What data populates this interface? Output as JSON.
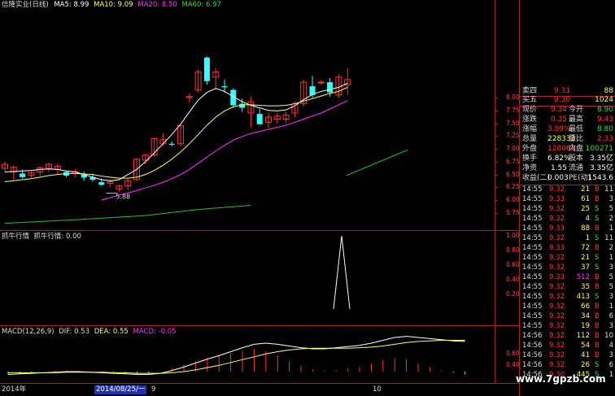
{
  "main_chart": {
    "title": "信隆实业(日线)",
    "ma5": {
      "label": "MA5:",
      "value": "8.99",
      "color": "#ffffff"
    },
    "ma10": {
      "label": "MA10:",
      "value": "9.09",
      "color": "#ffff66"
    },
    "ma20": {
      "label": "MA20:",
      "value": "8.50",
      "color": "#ff33ff"
    },
    "ma60": {
      "label": "MA60:",
      "value": "6.97",
      "color": "#33dd33"
    },
    "low_label": "5.88",
    "y_ticks": [
      "8.00",
      "7.75",
      "7.50",
      "7.25",
      "7.00",
      "6.75",
      "6.50",
      "6.25",
      "6.00",
      "5.75"
    ],
    "candles": [
      {
        "o": 6.62,
        "h": 6.75,
        "l": 6.55,
        "c": 6.7
      },
      {
        "o": 6.55,
        "h": 6.68,
        "l": 6.4,
        "c": 6.64
      },
      {
        "o": 6.52,
        "h": 6.6,
        "l": 6.42,
        "c": 6.45
      },
      {
        "o": 6.49,
        "h": 6.56,
        "l": 6.44,
        "c": 6.54
      },
      {
        "o": 6.55,
        "h": 6.66,
        "l": 6.48,
        "c": 6.63
      },
      {
        "o": 6.62,
        "h": 6.73,
        "l": 6.55,
        "c": 6.7
      },
      {
        "o": 6.6,
        "h": 6.7,
        "l": 6.5,
        "c": 6.66
      },
      {
        "o": 6.55,
        "h": 6.58,
        "l": 6.45,
        "c": 6.48
      },
      {
        "o": 6.52,
        "h": 6.6,
        "l": 6.45,
        "c": 6.56
      },
      {
        "o": 6.5,
        "h": 6.56,
        "l": 6.38,
        "c": 6.44
      },
      {
        "o": 6.45,
        "h": 6.52,
        "l": 6.36,
        "c": 6.4
      },
      {
        "o": 6.35,
        "h": 6.42,
        "l": 6.28,
        "c": 6.3
      },
      {
        "o": 6.33,
        "h": 6.4,
        "l": 6.26,
        "c": 6.36
      },
      {
        "o": 6.22,
        "h": 6.3,
        "l": 6.17,
        "c": 6.28
      },
      {
        "o": 6.28,
        "h": 6.42,
        "l": 6.2,
        "c": 6.38
      },
      {
        "o": 6.4,
        "h": 6.82,
        "l": 6.38,
        "c": 6.8
      },
      {
        "o": 6.78,
        "h": 6.9,
        "l": 6.7,
        "c": 6.88
      },
      {
        "o": 6.88,
        "h": 7.22,
        "l": 6.85,
        "c": 7.2
      },
      {
        "o": 7.1,
        "h": 7.3,
        "l": 7.05,
        "c": 7.18
      },
      {
        "o": 7.1,
        "h": 7.15,
        "l": 7.05,
        "c": 7.08
      },
      {
        "o": 7.1,
        "h": 7.48,
        "l": 7.05,
        "c": 7.45
      },
      {
        "o": 8.0,
        "h": 8.08,
        "l": 7.9,
        "c": 8.02
      },
      {
        "o": 8.15,
        "h": 8.55,
        "l": 8.1,
        "c": 8.5
      },
      {
        "o": 8.78,
        "h": 8.8,
        "l": 8.25,
        "c": 8.32
      },
      {
        "o": 8.4,
        "h": 8.58,
        "l": 8.15,
        "c": 8.5
      },
      {
        "o": 8.22,
        "h": 8.35,
        "l": 8.1,
        "c": 8.2
      },
      {
        "o": 8.15,
        "h": 8.18,
        "l": 7.8,
        "c": 7.85
      },
      {
        "o": 7.88,
        "h": 7.98,
        "l": 7.72,
        "c": 7.8
      },
      {
        "o": 7.7,
        "h": 8.02,
        "l": 7.42,
        "c": 7.92
      },
      {
        "o": 7.68,
        "h": 7.78,
        "l": 7.5,
        "c": 7.48
      },
      {
        "o": 7.52,
        "h": 7.7,
        "l": 7.4,
        "c": 7.62
      },
      {
        "o": 7.58,
        "h": 7.7,
        "l": 7.5,
        "c": 7.64
      },
      {
        "o": 7.58,
        "h": 7.72,
        "l": 7.5,
        "c": 7.66
      },
      {
        "o": 7.7,
        "h": 7.92,
        "l": 7.62,
        "c": 7.88
      },
      {
        "o": 7.88,
        "h": 8.35,
        "l": 7.82,
        "c": 8.3
      },
      {
        "o": 8.22,
        "h": 8.42,
        "l": 8.0,
        "c": 8.05
      },
      {
        "o": 8.3,
        "h": 8.34,
        "l": 8.26,
        "c": 8.3
      },
      {
        "o": 8.3,
        "h": 8.38,
        "l": 8.02,
        "c": 8.1
      },
      {
        "o": 8.05,
        "h": 8.45,
        "l": 8.0,
        "c": 8.4
      },
      {
        "o": 8.25,
        "h": 8.58,
        "l": 8.05,
        "c": 8.35
      }
    ],
    "ma5_series": [
      6.55,
      6.56,
      6.57,
      6.58,
      6.6,
      6.61,
      6.6,
      6.57,
      6.55,
      6.5,
      6.45,
      6.4,
      6.38,
      6.4,
      6.5,
      6.6,
      6.75,
      6.92,
      7.1,
      7.28,
      7.48,
      7.72,
      7.95,
      8.1,
      8.18,
      8.12,
      8.02,
      7.92,
      7.85,
      7.8,
      7.75,
      7.74,
      7.76,
      7.84,
      7.96,
      8.06,
      8.12,
      8.16,
      8.2,
      8.28
    ],
    "ma10_series": [
      6.36,
      6.38,
      6.4,
      6.42,
      6.45,
      6.48,
      6.5,
      6.52,
      6.52,
      6.51,
      6.5,
      6.47,
      6.45,
      6.43,
      6.43,
      6.45,
      6.5,
      6.58,
      6.68,
      6.8,
      6.94,
      7.1,
      7.28,
      7.46,
      7.62,
      7.74,
      7.82,
      7.86,
      7.86,
      7.85,
      7.84,
      7.84,
      7.85,
      7.88,
      7.93,
      7.98,
      8.03,
      8.08,
      8.12,
      8.2
    ],
    "ma20_series": [
      null,
      null,
      null,
      null,
      null,
      null,
      null,
      null,
      null,
      null,
      null,
      6.0,
      6.05,
      6.1,
      6.14,
      6.19,
      6.24,
      6.29,
      6.35,
      6.42,
      6.5,
      6.6,
      6.72,
      6.84,
      6.96,
      7.07,
      7.17,
      7.24,
      7.3,
      7.34,
      7.38,
      7.42,
      7.46,
      7.52,
      7.58,
      7.64,
      7.7,
      7.78,
      7.86,
      7.94
    ],
    "ma60_series": [
      {
        "x": 0,
        "v": 5.55
      },
      {
        "x": 8,
        "v": 5.62
      },
      {
        "x": 16,
        "v": 5.7
      },
      {
        "x": 22,
        "v": 5.82
      },
      {
        "x": 28,
        "v": 5.9
      },
      {
        "x": 30,
        "v": null
      },
      {
        "x": 32,
        "v": 6.48
      },
      {
        "x": 39,
        "v": 6.98
      }
    ]
  },
  "indicator": {
    "name": "抓牛行情",
    "label": "抓牛行情: 0.00",
    "y_ticks": [
      "1.00",
      "0.80",
      "0.60",
      "0.40",
      "0.20"
    ],
    "spike_index": 31
  },
  "macd": {
    "label": "MACD(12,26,9)",
    "dif": "DIF: 0.53",
    "dea": "DEA: 0.55",
    "macd_val": "MACD: -0.05",
    "y_ticks": [
      "0.60",
      "0.40"
    ],
    "dif_series": [
      -0.05,
      -0.04,
      -0.03,
      -0.02,
      -0.01,
      0.0,
      0.0,
      -0.01,
      -0.02,
      -0.03,
      -0.04,
      -0.05,
      -0.05,
      -0.03,
      0.02,
      0.08,
      0.15,
      0.22,
      0.28,
      0.35,
      0.42,
      0.48,
      0.5,
      0.48,
      0.45,
      0.42,
      0.4,
      0.4,
      0.42,
      0.44,
      0.46,
      0.5,
      0.55,
      0.6,
      0.62,
      0.6,
      0.58,
      0.56,
      0.54,
      0.53
    ],
    "dea_series": [
      -0.02,
      -0.02,
      -0.02,
      -0.02,
      -0.02,
      -0.01,
      -0.01,
      -0.01,
      -0.01,
      -0.02,
      -0.02,
      -0.03,
      -0.03,
      -0.03,
      -0.02,
      0.0,
      0.03,
      0.07,
      0.11,
      0.16,
      0.21,
      0.26,
      0.31,
      0.35,
      0.38,
      0.4,
      0.41,
      0.41,
      0.41,
      0.41,
      0.42,
      0.43,
      0.45,
      0.48,
      0.51,
      0.53,
      0.54,
      0.55,
      0.55,
      0.55
    ],
    "hist_series": [
      -0.05,
      -0.04,
      -0.02,
      0.0,
      0.02,
      0.02,
      0.01,
      -0.01,
      -0.02,
      -0.03,
      -0.04,
      -0.04,
      -0.04,
      0.0,
      0.06,
      0.12,
      0.18,
      0.24,
      0.28,
      0.32,
      0.36,
      0.4,
      0.36,
      0.28,
      0.18,
      0.1,
      0.04,
      0.02,
      0.02,
      0.06,
      0.08,
      0.14,
      0.2,
      0.24,
      0.22,
      0.14,
      0.08,
      0.02,
      -0.02,
      -0.05
    ]
  },
  "date_axis": {
    "year": "2014年",
    "highlight": "2014/08/25/一",
    "m9": "9",
    "m10": "10"
  },
  "quote": {
    "sell4_label": "卖四",
    "sell4_price": "9.31",
    "sell4_vol": "88",
    "buy5_label": "买五",
    "buy5_price": "9.30",
    "buy5_vol": "1024",
    "rows": [
      {
        "k1": "现价",
        "v1": "9.34",
        "c1": "#ff3333",
        "k2": "今开",
        "v2": "8.90",
        "c2": "#33dd33"
      },
      {
        "k1": "涨跌",
        "v1": "0.35",
        "c1": "#ff3333",
        "k2": "最高",
        "v2": "9.43",
        "c2": "#ff3333"
      },
      {
        "k1": "涨幅",
        "v1": "3.89%",
        "c1": "#ff3333",
        "k2": "最低",
        "v2": "8.80",
        "c2": "#33dd33"
      },
      {
        "k1": "总量",
        "v1": "228333",
        "c1": "#ffff55",
        "k2": "量比",
        "v2": "2.33",
        "c2": "#ff3333"
      },
      {
        "k1": "外盘",
        "v1": "128062",
        "c1": "#ff3333",
        "k2": "内盘",
        "v2": "100271",
        "c2": "#33dd33"
      },
      {
        "k1": "换手",
        "v1": "6.82%",
        "c1": "#ffffff",
        "k2": "股本",
        "v2": "3.35亿",
        "c2": "#ffffff"
      },
      {
        "k1": "净资",
        "v1": "1.55",
        "c1": "#ffffff",
        "k2": "流通",
        "v2": "3.35亿",
        "c2": "#ffffff"
      },
      {
        "k1": "收益(二)",
        "v1": "0.003",
        "c1": "#ffffff",
        "k2": "PE(动)",
        "v2": "1543.6",
        "c2": "#ffffff"
      }
    ],
    "trades": [
      {
        "t": "14:55",
        "p": "9.32",
        "v": "21",
        "d": "B"
      },
      {
        "t": "14:55",
        "p": "9.33",
        "v": "61",
        "d": "B"
      },
      {
        "t": "14:55",
        "p": "9.32",
        "v": "25",
        "d": "S"
      },
      {
        "t": "14:55",
        "p": "9.32",
        "v": "4",
        "d": "S"
      },
      {
        "t": "14:55",
        "p": "9.33",
        "v": "88",
        "d": "B"
      },
      {
        "t": "14:55",
        "p": "9.32",
        "v": "1",
        "d": "S"
      },
      {
        "t": "14:55",
        "p": "9.33",
        "v": "72",
        "d": "B"
      },
      {
        "t": "14:55",
        "p": "9.32",
        "v": "21",
        "d": "S"
      },
      {
        "t": "14:55",
        "p": "9.32",
        "v": "37",
        "d": "S"
      },
      {
        "t": "14:55",
        "p": "9.33",
        "v": "512",
        "d": "B"
      },
      {
        "t": "14:55",
        "p": "9.32",
        "v": "35",
        "d": "B"
      },
      {
        "t": "14:55",
        "p": "9.32",
        "v": "413",
        "d": "S"
      },
      {
        "t": "14:55",
        "p": "9.32",
        "v": "66",
        "d": "B"
      },
      {
        "t": "14:55",
        "p": "9.32",
        "v": "34",
        "d": "B"
      },
      {
        "t": "14:55",
        "p": "9.32",
        "v": "19",
        "d": "B"
      },
      {
        "t": "14:56",
        "p": "9.32",
        "v": "112",
        "d": "B"
      },
      {
        "t": "14:56",
        "p": "9.32",
        "v": "54",
        "d": "B"
      },
      {
        "t": "14:56",
        "p": "9.32",
        "v": "41",
        "d": "B"
      },
      {
        "t": "14:56",
        "p": "9.32",
        "v": "26",
        "d": "S"
      },
      {
        "t": "14:56",
        "p": "9.30",
        "v": "445",
        "d": "S"
      }
    ],
    "trade_ticks": [
      "11",
      "3",
      "5",
      "2",
      "1",
      "11",
      "2",
      "1",
      "3",
      "5",
      "5",
      "3",
      "1",
      "6",
      "3",
      "10",
      "4",
      "3",
      "6",
      "1"
    ]
  },
  "watermark": "www.7gpzb.com"
}
